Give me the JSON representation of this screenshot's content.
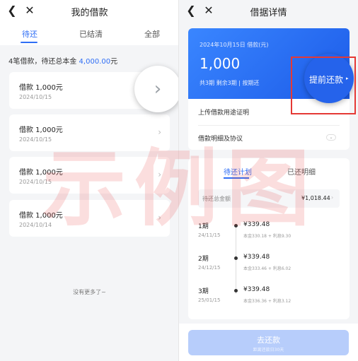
{
  "left": {
    "nav": {
      "title": "我的借款",
      "back_icon": "chevron-left-icon",
      "close_icon": "close-icon"
    },
    "tabs": [
      {
        "label": "待还",
        "active": true
      },
      {
        "label": "已结清",
        "active": false
      },
      {
        "label": "全部",
        "active": false
      }
    ],
    "summary": {
      "prefix": "4笔借款，待还总本金 ",
      "amount": "4,000.00",
      "suffix": "元"
    },
    "loans": [
      {
        "title": "借款  1,000元",
        "date": "2024/10/15"
      },
      {
        "title": "借款  1,000元",
        "date": "2024/10/15"
      },
      {
        "title": "借款  1,000元",
        "date": "2024/10/15"
      },
      {
        "title": "借款  1,000元",
        "date": "2024/10/14"
      }
    ],
    "no_more": "没有更多了~"
  },
  "right": {
    "nav": {
      "title": "借据详情",
      "back_icon": "chevron-left-icon",
      "close_icon": "close-icon"
    },
    "header": {
      "date_line": "2024年10月15日 借款(元)",
      "amount": "1,000",
      "terms": "共3期 剩余3期 | 按期还"
    },
    "prepay": {
      "label": "提前还款",
      "arrow": "▸"
    },
    "rows": [
      {
        "label": "上传借款用途证明"
      },
      {
        "label": "借款明细及协议"
      }
    ],
    "plan_tabs": [
      {
        "label": "待还计划",
        "active": true
      },
      {
        "label": "已还明细",
        "active": false
      }
    ],
    "total": {
      "label": "待还总金额",
      "amount": "¥1,018.44"
    },
    "installments": [
      {
        "period": "1期",
        "date": "24/11/15",
        "amount": "¥339.48",
        "detail": "本金330.18 + 利息9.30"
      },
      {
        "period": "2期",
        "date": "24/12/15",
        "amount": "¥339.48",
        "detail": "本金333.46 + 利息6.02"
      },
      {
        "period": "3期",
        "date": "25/01/15",
        "amount": "¥339.48",
        "detail": "本金336.36 + 利息3.12"
      }
    ],
    "pay_button": {
      "label": "去还款",
      "sub": "距离还款日30天"
    }
  },
  "watermark": {
    "text": [
      "示",
      "例",
      "图"
    ],
    "color": "#e84646"
  },
  "colors": {
    "accent": "#2f6ef5",
    "highlight_box": "#e53935"
  }
}
